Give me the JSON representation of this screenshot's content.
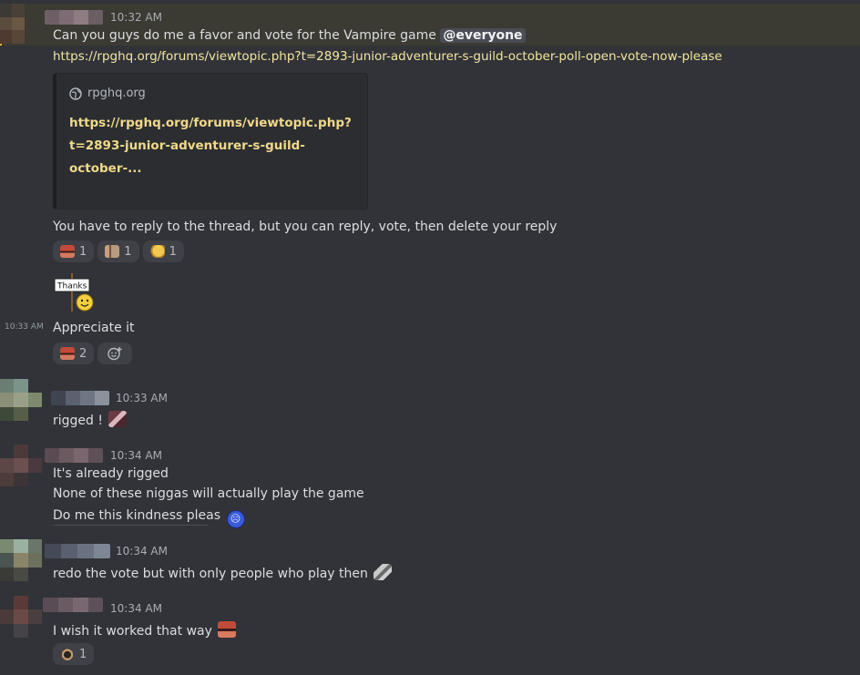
{
  "messages": {
    "m1": {
      "timestamp": "10:32 AM",
      "text": "Can you guys do me a favor and vote for the Vampire game",
      "mention": "@everyone",
      "url": "https://rpghq.org/forums/viewtopic.php?t=2893-junior-adventurer-s-guild-october-poll-open-vote-now-please",
      "embed": {
        "site": "rpghq.org",
        "title_line1": "https://rpghq.org/forums/viewtopic.php?",
        "title_line2": "t=2893-junior-adventurer-s-guild-october-..."
      },
      "followup": "You have to reply to the thread, but you can reply, vote, then delete your reply",
      "reactions": [
        {
          "emoji": "mad-face-emoji",
          "count": "1"
        },
        {
          "emoji": "pointing-emoji",
          "count": "1"
        },
        {
          "emoji": "thumbs-emoji",
          "count": "1"
        }
      ],
      "sticker_text": "Thanks"
    },
    "m2": {
      "timestamp": "10:33 AM",
      "text": "Appreciate it",
      "reactions": [
        {
          "emoji": "mad-face-emoji",
          "count": "2"
        }
      ]
    },
    "m3": {
      "timestamp": "10:33 AM",
      "text": "rigged !"
    },
    "m4": {
      "timestamp": "10:34 AM",
      "lines": [
        "It's already rigged",
        "None of these niggas will actually play the game",
        "Do me this kindness pleas"
      ]
    },
    "m5": {
      "timestamp": "10:34 AM",
      "text": "redo the vote but with only people who play then"
    },
    "m6": {
      "timestamp": "10:34 AM",
      "text": "I wish it worked that way",
      "reactions": [
        {
          "emoji": "cat-emoji",
          "count": "1"
        }
      ]
    }
  },
  "colors": {
    "background": "#313338",
    "mention_highlight": "#3b3a33",
    "link": "#f3e5a0",
    "reaction_bg": "#3f4147"
  }
}
